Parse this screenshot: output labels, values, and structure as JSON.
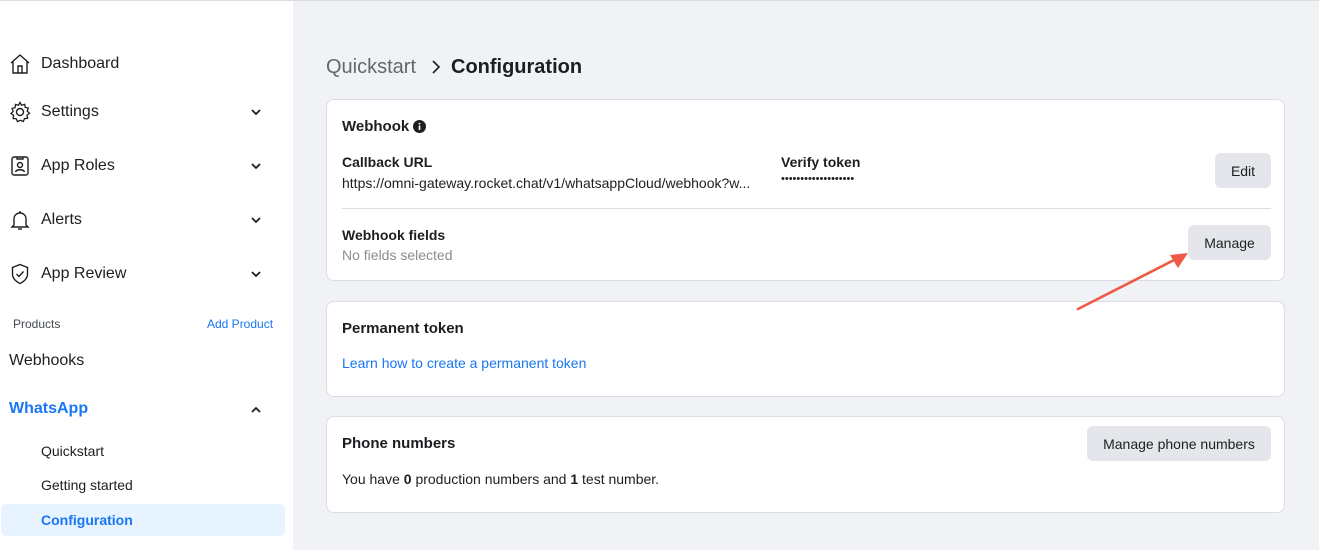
{
  "sidebar": {
    "items": [
      {
        "label": "Dashboard",
        "icon": "home-icon"
      },
      {
        "label": "Settings",
        "icon": "gear-icon"
      },
      {
        "label": "App Roles",
        "icon": "id-badge-icon"
      },
      {
        "label": "Alerts",
        "icon": "bell-icon"
      },
      {
        "label": "App Review",
        "icon": "shield-check-icon"
      }
    ],
    "products_label": "Products",
    "add_product": "Add Product",
    "webhooks": "Webhooks",
    "whatsapp": "WhatsApp",
    "whatsapp_sub": [
      "Quickstart",
      "Getting started",
      "Configuration"
    ]
  },
  "breadcrumb": {
    "root": "Quickstart",
    "current": "Configuration"
  },
  "webhook": {
    "title": "Webhook",
    "callback_label": "Callback URL",
    "callback_value": "https://omni-gateway.rocket.chat/v1/whatsappCloud/webhook?w...",
    "verify_label": "Verify token",
    "verify_value": "•••••••••••••••••••",
    "edit": "Edit",
    "fields_label": "Webhook fields",
    "fields_value": "No fields selected",
    "manage": "Manage"
  },
  "permanent_token": {
    "title": "Permanent token",
    "link": "Learn how to create a permanent token"
  },
  "phone_numbers": {
    "title": "Phone numbers",
    "manage": "Manage phone numbers",
    "text_prefix": "You have ",
    "production_count": "0",
    "text_mid": " production numbers and ",
    "test_count": "1",
    "text_suffix": " test number."
  },
  "colors": {
    "accent": "#1877f2",
    "annotation_arrow": "#ee5a46"
  }
}
